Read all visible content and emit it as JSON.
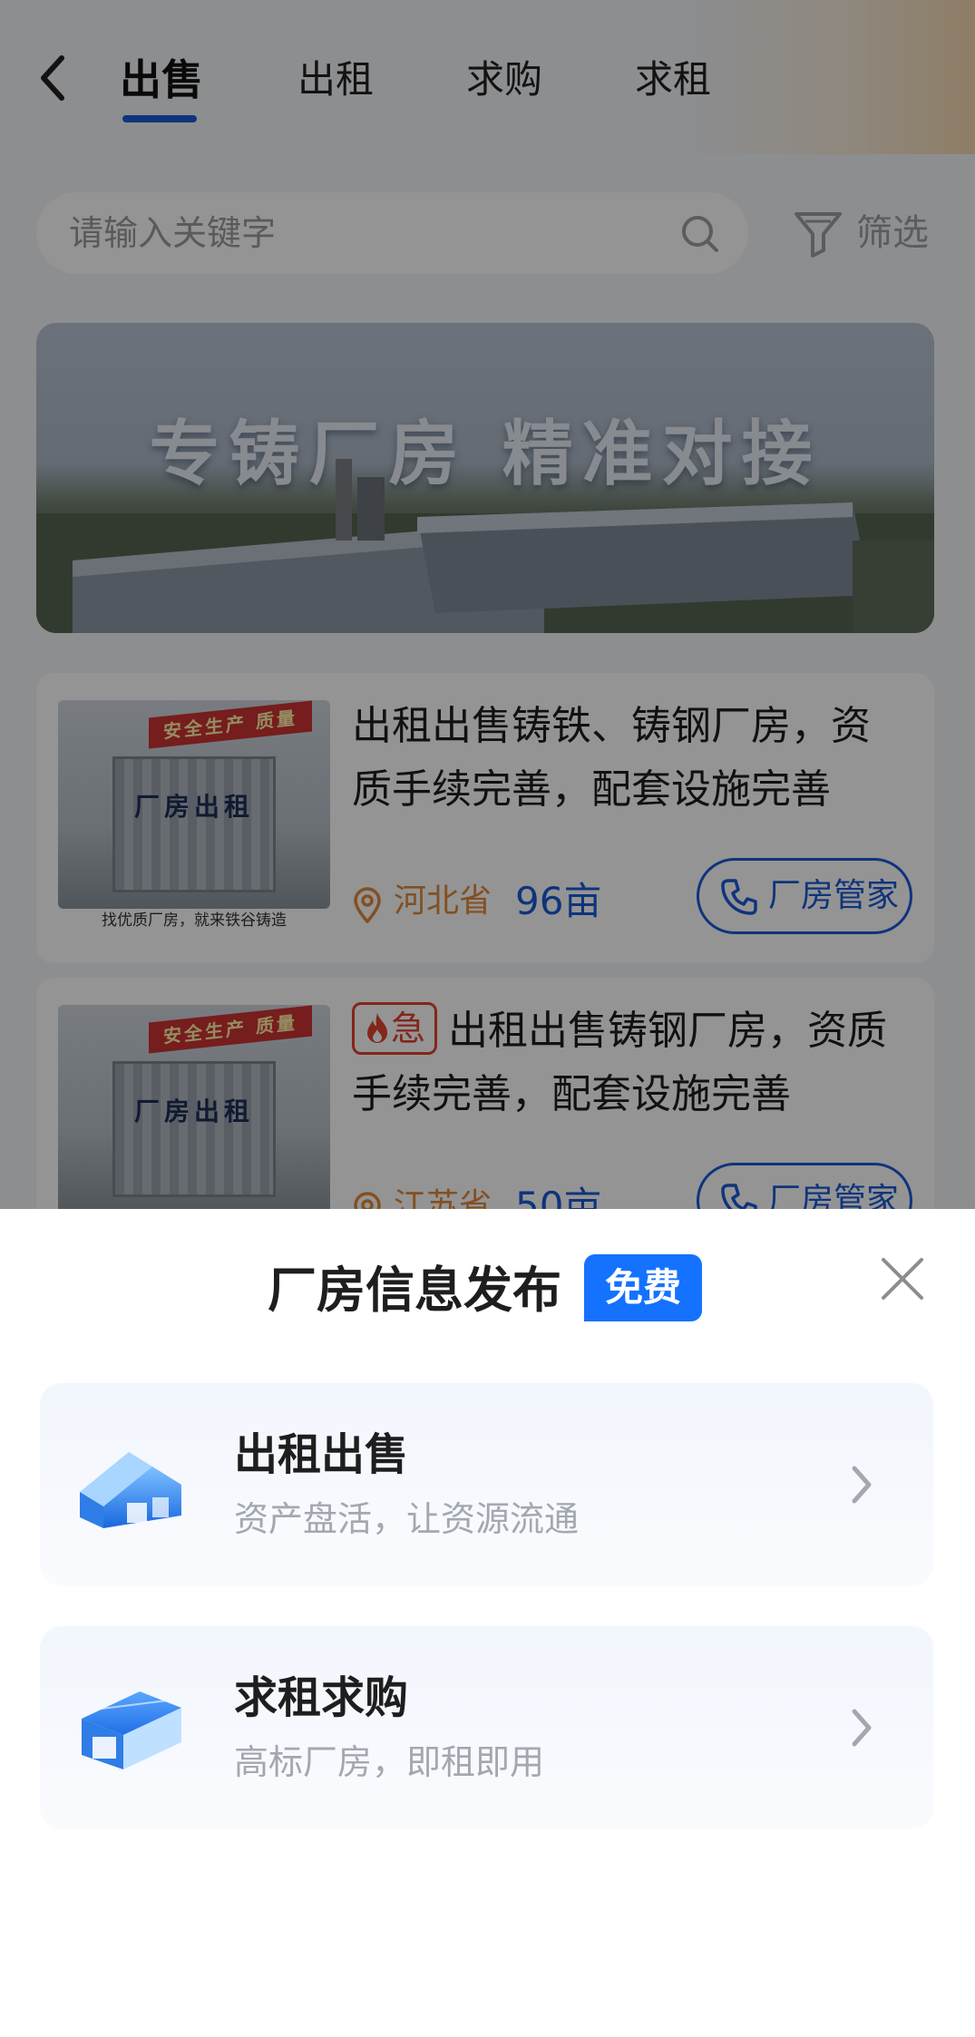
{
  "header": {
    "tabs": [
      {
        "label": "出售",
        "active": true
      },
      {
        "label": "出租",
        "active": false
      },
      {
        "label": "求购",
        "active": false
      },
      {
        "label": "求租",
        "active": false
      }
    ]
  },
  "search": {
    "placeholder": "请输入关键字",
    "filter_label": "筛选"
  },
  "banner": {
    "text": "专铸厂房  精准对接"
  },
  "listings": [
    {
      "thumb_sign": "安全生产 质量",
      "thumb_label": "厂房出租",
      "thumb_caption": "找优质厂房，就来铁谷铸造",
      "title": "出租出售铸铁、铸钢厂房，资质手续完善，配套设施完善",
      "urgent": false,
      "location": "河北省",
      "area": "96亩",
      "agent_label": "厂房管家"
    },
    {
      "thumb_sign": "安全生产 质量",
      "thumb_label": "厂房出租",
      "thumb_caption": "",
      "title": "出租出售铸钢厂房，资质手续完善，配套设施完善",
      "urgent": true,
      "urgent_label": "急",
      "location": "江苏省",
      "area": "50亩",
      "agent_label": "厂房管家"
    }
  ],
  "sheet": {
    "title": "厂房信息发布",
    "badge": "免费",
    "options": [
      {
        "title": "出租出售",
        "subtitle": "资产盘活，让资源流通",
        "icon": "warehouse-icon"
      },
      {
        "title": "求租求购",
        "subtitle": "高标厂房，即租即用",
        "icon": "factory-building-icon"
      }
    ]
  },
  "colors": {
    "primary": "#1a5ad6",
    "badge_blue": "#1472ff",
    "urgent_red": "#e2432f",
    "location_orange": "#e08a3c"
  }
}
